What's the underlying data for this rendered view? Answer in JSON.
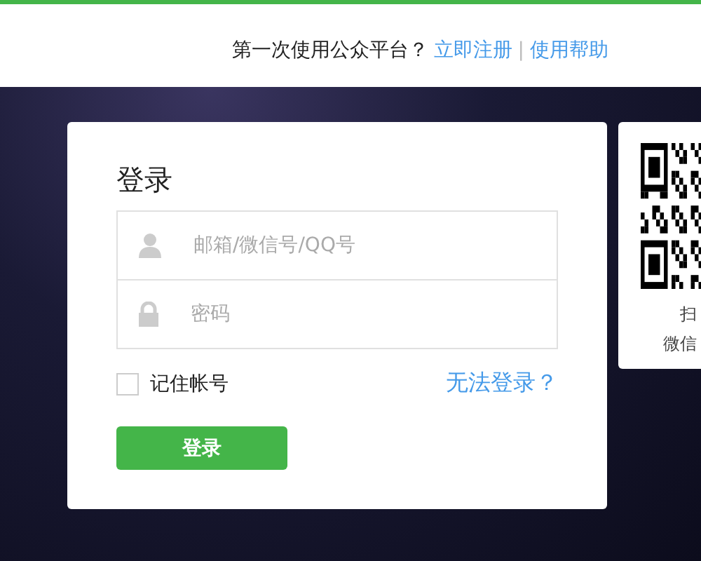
{
  "header": {
    "prompt": "第一次使用公众平台？",
    "links": [
      "立即注册",
      "使用帮助"
    ],
    "separator": "|"
  },
  "login": {
    "title": "登录",
    "fields": [
      {
        "kind": "account",
        "placeholder": "邮箱/微信号/QQ号"
      },
      {
        "kind": "password",
        "placeholder": "密码"
      }
    ],
    "remember": {
      "label": "记住帐号",
      "checked": false
    },
    "help_link": "无法登录？",
    "button": "登录"
  },
  "qr_panel": {
    "lines": [
      "扫",
      "微信"
    ]
  }
}
